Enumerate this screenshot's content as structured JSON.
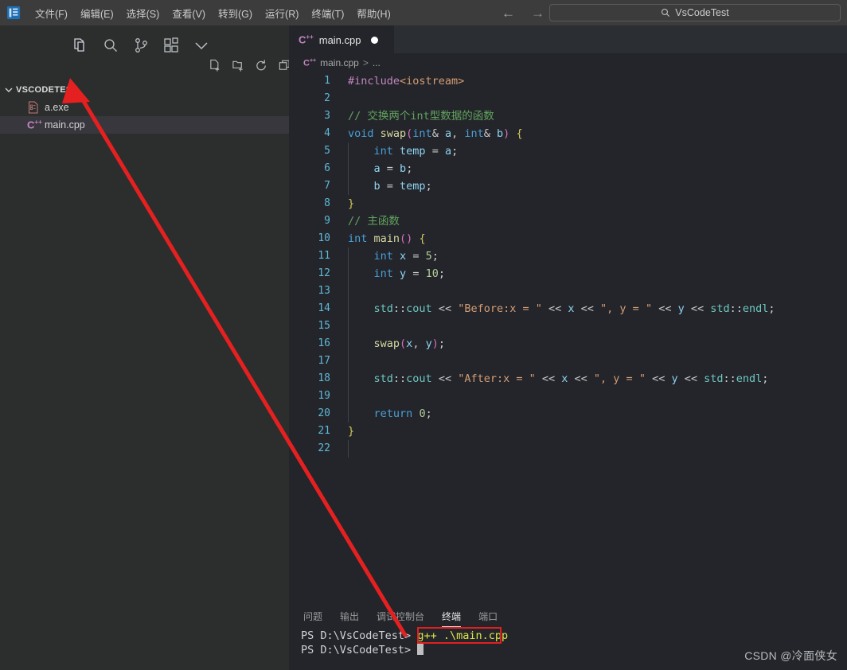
{
  "window": {
    "logo_icon": "vscode-logo-icon",
    "search_placeholder_text": "VsCodeTest",
    "search_icon": "search-icon",
    "back_arrow": "←",
    "forward_arrow": "→"
  },
  "menu": {
    "items": [
      {
        "label": "文件(F)",
        "name": "menu-file"
      },
      {
        "label": "编辑(E)",
        "name": "menu-edit"
      },
      {
        "label": "选择(S)",
        "name": "menu-selection"
      },
      {
        "label": "查看(V)",
        "name": "menu-view"
      },
      {
        "label": "转到(G)",
        "name": "menu-goto"
      },
      {
        "label": "运行(R)",
        "name": "menu-run"
      },
      {
        "label": "终端(T)",
        "name": "menu-terminal"
      },
      {
        "label": "帮助(H)",
        "name": "menu-help"
      }
    ]
  },
  "sidebar": {
    "icons": [
      {
        "name": "explorer-icon",
        "active": true
      },
      {
        "name": "search-icon",
        "active": false
      },
      {
        "name": "source-control-icon",
        "active": false
      },
      {
        "name": "extensions-icon",
        "active": false
      },
      {
        "name": "chevron-down-icon",
        "active": false
      }
    ],
    "explorer_title": "VSCODETEST",
    "explorer_chevron": "chevron-down-icon",
    "actions": [
      {
        "name": "new-file-icon"
      },
      {
        "name": "new-folder-icon"
      },
      {
        "name": "refresh-icon"
      },
      {
        "name": "collapse-all-icon"
      }
    ],
    "files": [
      {
        "name": "a.exe",
        "icon": "binary-file-icon",
        "selected": false
      },
      {
        "name": "main.cpp",
        "icon": "cpp-file-icon",
        "selected": true
      }
    ]
  },
  "editor": {
    "tab": {
      "label": "main.cpp",
      "icon": "cpp-file-icon",
      "dirty": true
    },
    "breadcrumb": {
      "file": "main.cpp",
      "separator": ">",
      "rest": "..."
    },
    "lines": [
      {
        "n": 1,
        "tokens": [
          {
            "t": "#include",
            "c": "pre"
          },
          {
            "t": "<iostream>",
            "c": "inc"
          }
        ]
      },
      {
        "n": 2,
        "tokens": []
      },
      {
        "n": 3,
        "tokens": [
          {
            "t": "// 交换两个int型数据的函数",
            "c": "cm"
          }
        ]
      },
      {
        "n": 4,
        "tokens": [
          {
            "t": "void ",
            "c": "k"
          },
          {
            "t": "swap",
            "c": "fn"
          },
          {
            "t": "(",
            "c": "par"
          },
          {
            "t": "int",
            "c": "k"
          },
          {
            "t": "& ",
            "c": "op"
          },
          {
            "t": "a",
            "c": "var"
          },
          {
            "t": ", ",
            "c": "op"
          },
          {
            "t": "int",
            "c": "k"
          },
          {
            "t": "& ",
            "c": "op"
          },
          {
            "t": "b",
            "c": "var"
          },
          {
            "t": ")",
            "c": "par"
          },
          {
            "t": " ",
            "c": "pl"
          },
          {
            "t": "{",
            "c": "br"
          }
        ]
      },
      {
        "n": 5,
        "indent": true,
        "tokens": [
          {
            "t": "    ",
            "c": "pl"
          },
          {
            "t": "int",
            "c": "k"
          },
          {
            "t": " ",
            "c": "pl"
          },
          {
            "t": "temp",
            "c": "var"
          },
          {
            "t": " = ",
            "c": "op"
          },
          {
            "t": "a",
            "c": "var"
          },
          {
            "t": ";",
            "c": "pl"
          }
        ]
      },
      {
        "n": 6,
        "indent": true,
        "tokens": [
          {
            "t": "    ",
            "c": "pl"
          },
          {
            "t": "a",
            "c": "var"
          },
          {
            "t": " = ",
            "c": "op"
          },
          {
            "t": "b",
            "c": "var"
          },
          {
            "t": ";",
            "c": "pl"
          }
        ]
      },
      {
        "n": 7,
        "indent": true,
        "tokens": [
          {
            "t": "    ",
            "c": "pl"
          },
          {
            "t": "b",
            "c": "var"
          },
          {
            "t": " = ",
            "c": "op"
          },
          {
            "t": "temp",
            "c": "var"
          },
          {
            "t": ";",
            "c": "pl"
          }
        ]
      },
      {
        "n": 8,
        "tokens": [
          {
            "t": "}",
            "c": "br"
          }
        ]
      },
      {
        "n": 9,
        "tokens": [
          {
            "t": "// 主函数",
            "c": "cm"
          }
        ]
      },
      {
        "n": 10,
        "tokens": [
          {
            "t": "int ",
            "c": "k"
          },
          {
            "t": "main",
            "c": "fn"
          },
          {
            "t": "()",
            "c": "par"
          },
          {
            "t": " ",
            "c": "pl"
          },
          {
            "t": "{",
            "c": "br"
          }
        ]
      },
      {
        "n": 11,
        "indent": true,
        "tokens": [
          {
            "t": "    ",
            "c": "pl"
          },
          {
            "t": "int",
            "c": "k"
          },
          {
            "t": " ",
            "c": "pl"
          },
          {
            "t": "x",
            "c": "var"
          },
          {
            "t": " = ",
            "c": "op"
          },
          {
            "t": "5",
            "c": "num"
          },
          {
            "t": ";",
            "c": "pl"
          }
        ]
      },
      {
        "n": 12,
        "indent": true,
        "tokens": [
          {
            "t": "    ",
            "c": "pl"
          },
          {
            "t": "int",
            "c": "k"
          },
          {
            "t": " ",
            "c": "pl"
          },
          {
            "t": "y",
            "c": "var"
          },
          {
            "t": " = ",
            "c": "op"
          },
          {
            "t": "10",
            "c": "num"
          },
          {
            "t": ";",
            "c": "pl"
          }
        ]
      },
      {
        "n": 13,
        "indent": true,
        "tokens": []
      },
      {
        "n": 14,
        "indent": true,
        "tokens": [
          {
            "t": "    ",
            "c": "pl"
          },
          {
            "t": "std",
            "c": "ns"
          },
          {
            "t": "::",
            "c": "pl"
          },
          {
            "t": "cout",
            "c": "ns"
          },
          {
            "t": " << ",
            "c": "op"
          },
          {
            "t": "\"Before:x = \"",
            "c": "str"
          },
          {
            "t": " << ",
            "c": "op"
          },
          {
            "t": "x",
            "c": "var"
          },
          {
            "t": " << ",
            "c": "op"
          },
          {
            "t": "\", y = \"",
            "c": "str"
          },
          {
            "t": " << ",
            "c": "op"
          },
          {
            "t": "y",
            "c": "var"
          },
          {
            "t": " << ",
            "c": "op"
          },
          {
            "t": "std",
            "c": "ns"
          },
          {
            "t": "::",
            "c": "pl"
          },
          {
            "t": "endl",
            "c": "ns"
          },
          {
            "t": ";",
            "c": "pl"
          }
        ]
      },
      {
        "n": 15,
        "indent": true,
        "tokens": []
      },
      {
        "n": 16,
        "indent": true,
        "tokens": [
          {
            "t": "    ",
            "c": "pl"
          },
          {
            "t": "swap",
            "c": "fn"
          },
          {
            "t": "(",
            "c": "par"
          },
          {
            "t": "x",
            "c": "var"
          },
          {
            "t": ", ",
            "c": "op"
          },
          {
            "t": "y",
            "c": "var"
          },
          {
            "t": ")",
            "c": "par"
          },
          {
            "t": ";",
            "c": "pl"
          }
        ]
      },
      {
        "n": 17,
        "indent": true,
        "tokens": []
      },
      {
        "n": 18,
        "indent": true,
        "tokens": [
          {
            "t": "    ",
            "c": "pl"
          },
          {
            "t": "std",
            "c": "ns"
          },
          {
            "t": "::",
            "c": "pl"
          },
          {
            "t": "cout",
            "c": "ns"
          },
          {
            "t": " << ",
            "c": "op"
          },
          {
            "t": "\"After:x = \"",
            "c": "str"
          },
          {
            "t": " << ",
            "c": "op"
          },
          {
            "t": "x",
            "c": "var"
          },
          {
            "t": " << ",
            "c": "op"
          },
          {
            "t": "\", y = \"",
            "c": "str"
          },
          {
            "t": " << ",
            "c": "op"
          },
          {
            "t": "y",
            "c": "var"
          },
          {
            "t": " << ",
            "c": "op"
          },
          {
            "t": "std",
            "c": "ns"
          },
          {
            "t": "::",
            "c": "pl"
          },
          {
            "t": "endl",
            "c": "ns"
          },
          {
            "t": ";",
            "c": "pl"
          }
        ]
      },
      {
        "n": 19,
        "indent": true,
        "tokens": []
      },
      {
        "n": 20,
        "indent": true,
        "tokens": [
          {
            "t": "    ",
            "c": "pl"
          },
          {
            "t": "return",
            "c": "k"
          },
          {
            "t": " ",
            "c": "pl"
          },
          {
            "t": "0",
            "c": "num"
          },
          {
            "t": ";",
            "c": "pl"
          }
        ]
      },
      {
        "n": 21,
        "tokens": [
          {
            "t": "}",
            "c": "br"
          }
        ]
      },
      {
        "n": 22,
        "indent": true,
        "tokens": []
      }
    ]
  },
  "panel": {
    "tabs": [
      {
        "label": "问题",
        "name": "panel-tab-problems",
        "active": false
      },
      {
        "label": "输出",
        "name": "panel-tab-output",
        "active": false
      },
      {
        "label": "调试控制台",
        "name": "panel-tab-debug-console",
        "active": false
      },
      {
        "label": "终端",
        "name": "panel-tab-terminal",
        "active": true
      },
      {
        "label": "端口",
        "name": "panel-tab-ports",
        "active": false
      }
    ],
    "terminal": {
      "prompt": "PS D:\\VsCodeTest> ",
      "command": "g++ .\\main.cpp",
      "prompt2": "PS D:\\VsCodeTest> "
    }
  },
  "annotation": {
    "arrow_color": "#e52020",
    "box_color": "#e02020"
  },
  "watermark": {
    "text": "CSDN @冷面侠女"
  }
}
